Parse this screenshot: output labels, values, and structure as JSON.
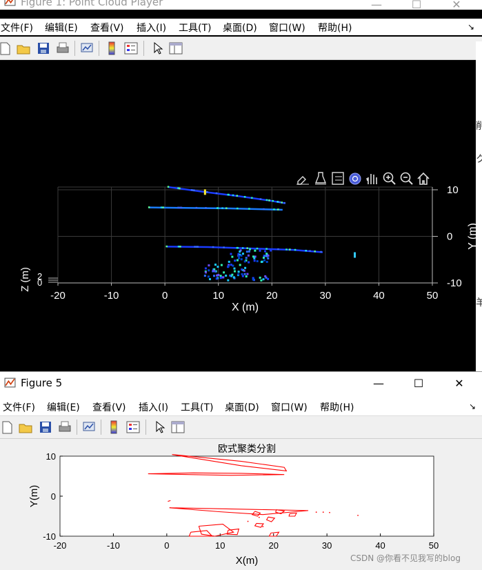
{
  "figure1": {
    "title": "Figure 1: Point Cloud Player",
    "menu": [
      "文件(F)",
      "编辑(E)",
      "查看(V)",
      "插入(I)",
      "工具(T)",
      "桌面(D)",
      "窗口(W)",
      "帮助(H)"
    ],
    "toolbar_icons": [
      "new-file-icon",
      "open-folder-icon",
      "save-icon",
      "print-icon",
      "link-plot-icon",
      "colorbar-icon",
      "legend-icon",
      "pointer-icon",
      "property-editor-icon"
    ],
    "axes_toolbar_icons": [
      "brush-icon",
      "data-tips-icon",
      "legend-toggle-icon",
      "rotate-icon",
      "pan-icon",
      "zoom-in-icon",
      "zoom-out-icon",
      "home-icon"
    ]
  },
  "figure5": {
    "title": "Figure 5",
    "menu": [
      "文件(F)",
      "编辑(E)",
      "查看(V)",
      "插入(I)",
      "工具(T)",
      "桌面(D)",
      "窗口(W)",
      "帮助(H)"
    ],
    "toolbar_icons": [
      "new-file-icon",
      "open-folder-icon",
      "save-icon",
      "print-icon",
      "link-plot-icon",
      "colorbar-icon",
      "legend-icon",
      "pointer-icon",
      "property-editor-icon"
    ]
  },
  "window_controls": {
    "minimize": "—",
    "maximize": "☐",
    "close": "✕"
  },
  "side_fragments": [
    "削",
    "ク",
    "羊"
  ],
  "watermark": "CSDN @你看不见我写的blog",
  "chart_data": [
    {
      "type": "scatter",
      "title": "",
      "xlabel": "X (m)",
      "ylabel": "Y (m)",
      "zlabel": "Z (m)",
      "xlim": [
        -20,
        50
      ],
      "ylim": [
        -10,
        10
      ],
      "xticks": [
        "-20",
        "-10",
        "0",
        "10",
        "20",
        "30",
        "40",
        "50"
      ],
      "yticks": [
        "10",
        "0",
        "-10"
      ],
      "zticks": [
        "2",
        "0"
      ],
      "background": "#000000",
      "grid": true,
      "colormap": "jet",
      "segments": [
        {
          "x": [
            0.6,
            7,
            14,
            20,
            22.5
          ],
          "y": [
            10.6,
            9.6,
            8.6,
            7.6,
            7.1
          ],
          "color": "#1a3cff"
        },
        {
          "x": [
            -3,
            5,
            12,
            22
          ],
          "y": [
            6.2,
            6.1,
            6.0,
            5.7
          ],
          "color": "#1a7cff"
        },
        {
          "x": [
            0.3,
            8,
            16,
            24,
            29.5
          ],
          "y": [
            -2.2,
            -2.3,
            -2.6,
            -2.9,
            -3.4
          ],
          "color": "#1a3cff"
        }
      ],
      "clusters": [
        {
          "xc": 16,
          "yc": -4.2,
          "spread": [
            8,
            3
          ],
          "n": 45
        },
        {
          "xc": 11.5,
          "yc": -7.8,
          "spread": [
            8,
            3.5
          ],
          "n": 55
        },
        {
          "xc": 18,
          "yc": -9,
          "spread": [
            3,
            1
          ],
          "n": 10
        }
      ],
      "highlights": [
        {
          "x": 7.5,
          "y": 9.5,
          "color": "#ffee33"
        },
        {
          "x": 35.5,
          "y": -4,
          "color": "#33ccff"
        }
      ]
    },
    {
      "type": "line",
      "title": "欧式聚类分割",
      "xlabel": "X(m)",
      "ylabel": "Y(m)",
      "xlim": [
        -20,
        50
      ],
      "ylim": [
        -10,
        10
      ],
      "xticks": [
        "-20",
        "-10",
        "0",
        "10",
        "20",
        "30",
        "40",
        "50"
      ],
      "yticks": [
        "10",
        "0",
        "-10"
      ],
      "series_color": "#ff0000",
      "polygons": [
        [
          [
            1,
            10.4
          ],
          [
            14,
            8.7
          ],
          [
            22,
            7.2
          ],
          [
            22.4,
            6.3
          ],
          [
            14,
            7.6
          ],
          [
            1,
            10.4
          ]
        ],
        [
          [
            -3.5,
            5.6
          ],
          [
            5,
            5.8
          ],
          [
            14,
            5.7
          ],
          [
            22,
            5.4
          ],
          [
            12,
            5.2
          ],
          [
            -3.5,
            5.6
          ]
        ],
        [
          [
            0.5,
            -2.9
          ],
          [
            8,
            -3.1
          ],
          [
            16,
            -3.3
          ],
          [
            26.5,
            -3.6
          ],
          [
            18,
            -4.6
          ],
          [
            10,
            -3.9
          ],
          [
            0.5,
            -2.9
          ]
        ],
        [
          [
            0.2,
            -1.3
          ],
          [
            0.7,
            -1.1
          ]
        ],
        [
          [
            16.5,
            -3.8
          ],
          [
            17.5,
            -4.2
          ],
          [
            17,
            -5
          ],
          [
            16,
            -4.6
          ],
          [
            16.5,
            -3.8
          ]
        ],
        [
          [
            19,
            -5.2
          ],
          [
            20.2,
            -5.5
          ],
          [
            19.6,
            -6.4
          ],
          [
            18.7,
            -5.9
          ],
          [
            19,
            -5.2
          ]
        ],
        [
          [
            16.8,
            -6.8
          ],
          [
            18.1,
            -6.9
          ],
          [
            17.6,
            -7.8
          ],
          [
            16.5,
            -7.4
          ],
          [
            16.8,
            -6.8
          ]
        ],
        [
          [
            6,
            -7.5
          ],
          [
            10.5,
            -7
          ],
          [
            12.5,
            -9
          ],
          [
            9,
            -10
          ],
          [
            6.5,
            -9.5
          ],
          [
            6,
            -7.5
          ]
        ],
        [
          [
            4.5,
            -9
          ],
          [
            7.5,
            -8.6
          ],
          [
            8.5,
            -10
          ],
          [
            4.2,
            -10
          ],
          [
            4.5,
            -9
          ]
        ],
        [
          [
            11.5,
            -8.5
          ],
          [
            13.5,
            -8.2
          ],
          [
            13.2,
            -9.6
          ],
          [
            11.3,
            -9.5
          ],
          [
            11.5,
            -8.5
          ]
        ],
        [
          [
            19.5,
            -9.2
          ],
          [
            21,
            -9
          ],
          [
            20.5,
            -10
          ],
          [
            19.2,
            -10
          ],
          [
            19.5,
            -9.2
          ]
        ],
        [
          [
            20.5,
            -3.4
          ],
          [
            22,
            -3.7
          ],
          [
            21.4,
            -4.4
          ],
          [
            20.4,
            -4
          ],
          [
            20.5,
            -3.4
          ]
        ],
        [
          [
            23,
            -4.4
          ],
          [
            24.3,
            -4.2
          ],
          [
            24,
            -5
          ],
          [
            22.9,
            -5
          ],
          [
            23,
            -4.4
          ]
        ]
      ],
      "dots": [
        [
          28,
          -4
        ],
        [
          29.3,
          -4
        ],
        [
          30.5,
          -4.1
        ],
        [
          35.8,
          -4.8
        ],
        [
          17.3,
          -5.3
        ],
        [
          18,
          -7.6
        ],
        [
          15.2,
          -6.3
        ]
      ]
    }
  ]
}
